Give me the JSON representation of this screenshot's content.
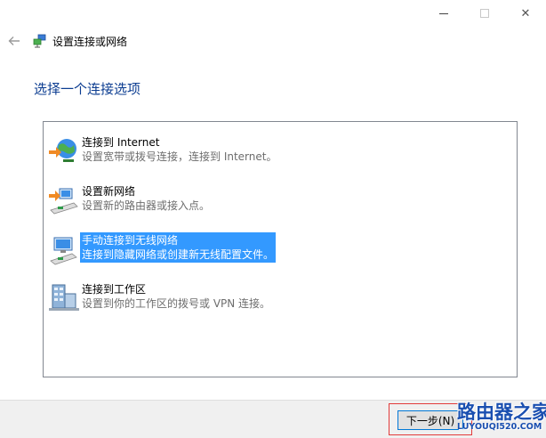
{
  "window": {
    "title": "设置连接或网络",
    "minimize_glyph": "—",
    "maximize_glyph": "☐",
    "close_glyph": "✕"
  },
  "heading": "选择一个连接选项",
  "options": [
    {
      "title": "连接到 Internet",
      "desc": "设置宽带或拨号连接，连接到 Internet。",
      "icon": "globe-network-icon",
      "selected": false
    },
    {
      "title": "设置新网络",
      "desc": "设置新的路由器或接入点。",
      "icon": "new-network-icon",
      "selected": false
    },
    {
      "title": "手动连接到无线网络",
      "desc": "连接到隐藏网络或创建新无线配置文件。",
      "icon": "wireless-network-icon",
      "selected": true
    },
    {
      "title": "连接到工作区",
      "desc": "设置到你的工作区的拨号或 VPN 连接。",
      "icon": "workplace-network-icon",
      "selected": false
    }
  ],
  "footer": {
    "next_label": "下一步(N)"
  },
  "watermark": {
    "cn": "路由器之家",
    "en": "LUYOUQI520.COM"
  },
  "colors": {
    "heading": "#0c3d91",
    "selection": "#3399ff",
    "annotation_box": "#e23b3b"
  }
}
